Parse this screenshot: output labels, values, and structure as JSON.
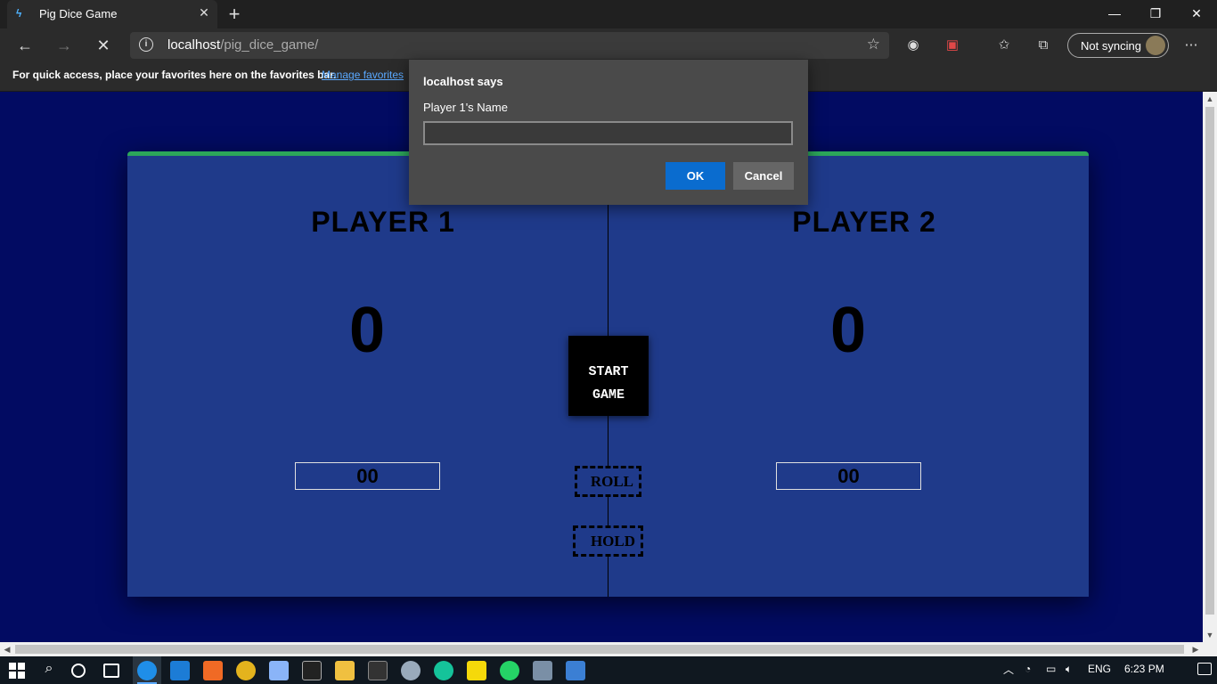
{
  "browser": {
    "tab_title": "Pig Dice Game",
    "tab_close": "✕",
    "new_tab": "+",
    "address_host": "localhost",
    "address_path": "/pig_dice_game/",
    "sync_label": "Not syncing",
    "favorites_bar_text": "For quick access, place your favorites here on the favorites bar.",
    "favorites_link": "Manage favorites"
  },
  "game": {
    "player1_name": "PLAYER 1",
    "player2_name": "PLAYER 2",
    "player1_score": "0",
    "player2_score": "0",
    "player1_current": "00",
    "player2_current": "00",
    "start_line1": "START",
    "start_line2": "GAME",
    "roll_label": "ROLL",
    "hold_label": "HOLD"
  },
  "dialog": {
    "title": "localhost says",
    "message": "Player 1's Name",
    "input_value": "",
    "ok_label": "OK",
    "cancel_label": "Cancel"
  },
  "taskbar": {
    "language": "ENG",
    "time": "6:23 PM"
  },
  "colors": {
    "page_background": "#020b62",
    "game_background": "#1f3a8a",
    "game_top_border": "#2ca65a",
    "ok_button": "#0a6ccf"
  }
}
